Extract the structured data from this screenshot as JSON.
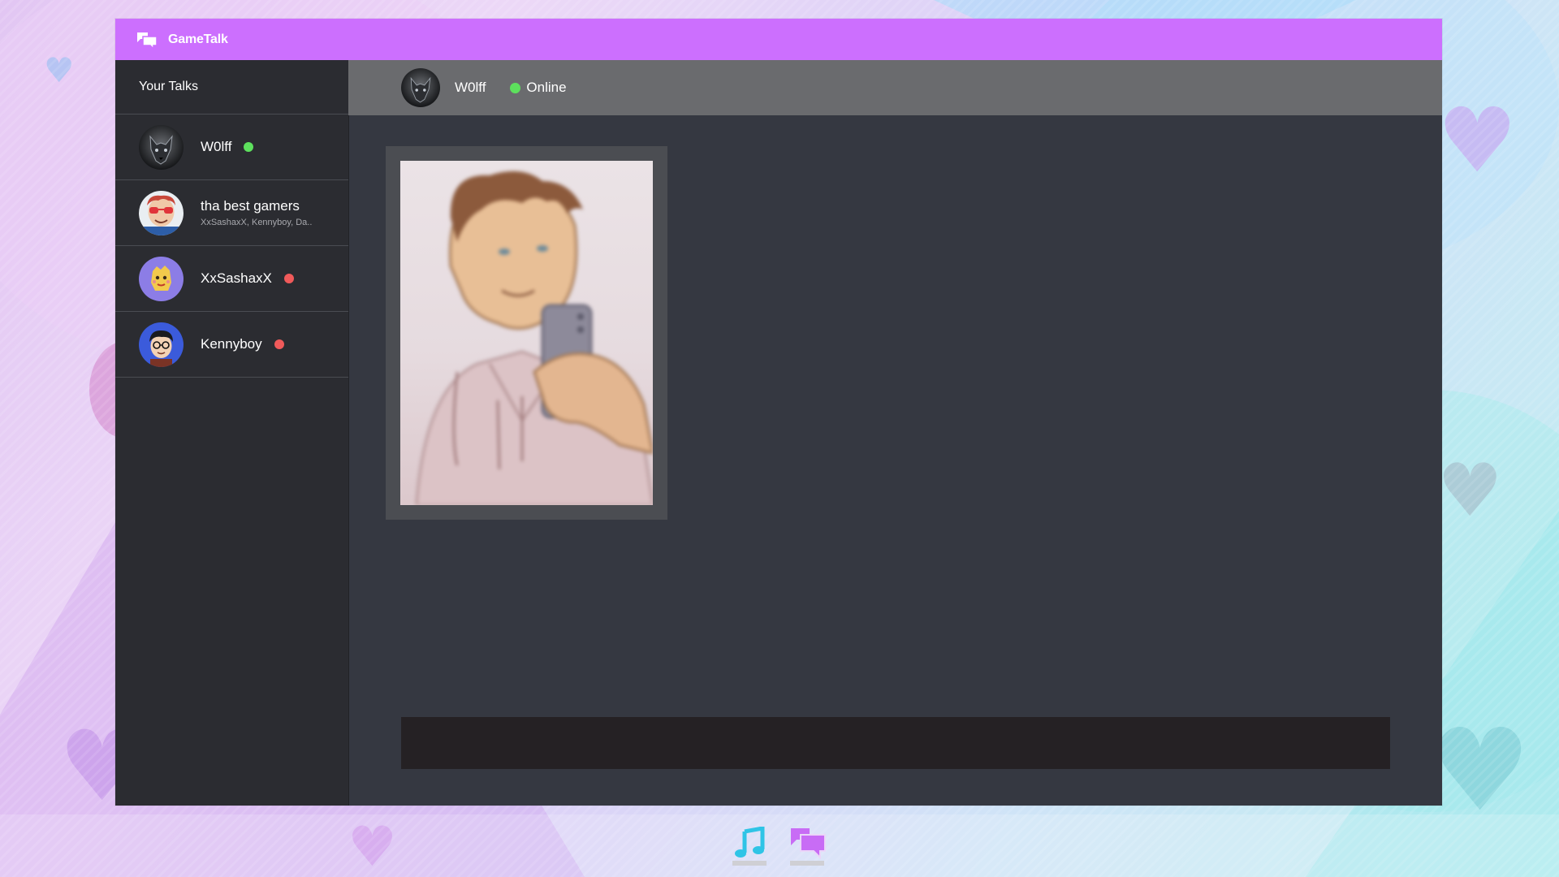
{
  "app": {
    "title": "GameTalk",
    "accent_color": "#cc6ffe",
    "icon": "chat-bubbles-icon"
  },
  "sidebar": {
    "header": "Your Talks",
    "talks": [
      {
        "name": "W0lff",
        "subtitle": "",
        "status": "online",
        "status_color": "#5de05d",
        "avatar": "wolf-avatar"
      },
      {
        "name": "tha best gamers",
        "subtitle": "XxSashaxX, Kennyboy, Da..",
        "status": "",
        "status_color": "",
        "avatar": "group-avatar"
      },
      {
        "name": "XxSashaxX",
        "subtitle": "",
        "status": "offline",
        "status_color": "#f05a5a",
        "avatar": "cartoon-avatar"
      },
      {
        "name": "Kennyboy",
        "subtitle": "",
        "status": "offline",
        "status_color": "#f05a5a",
        "avatar": "boy-avatar"
      }
    ]
  },
  "chat": {
    "user": "W0lff",
    "status": "Online",
    "status_color": "#5de05d",
    "messages": [
      {
        "type": "image",
        "content": "selfie-photo"
      }
    ],
    "composer": {
      "value": "",
      "placeholder": ""
    }
  },
  "taskbar": {
    "items": [
      {
        "icon": "music-note-icon",
        "color": "#2fc4e6"
      },
      {
        "icon": "chat-bubbles-icon",
        "color": "#c86cf5"
      }
    ]
  }
}
